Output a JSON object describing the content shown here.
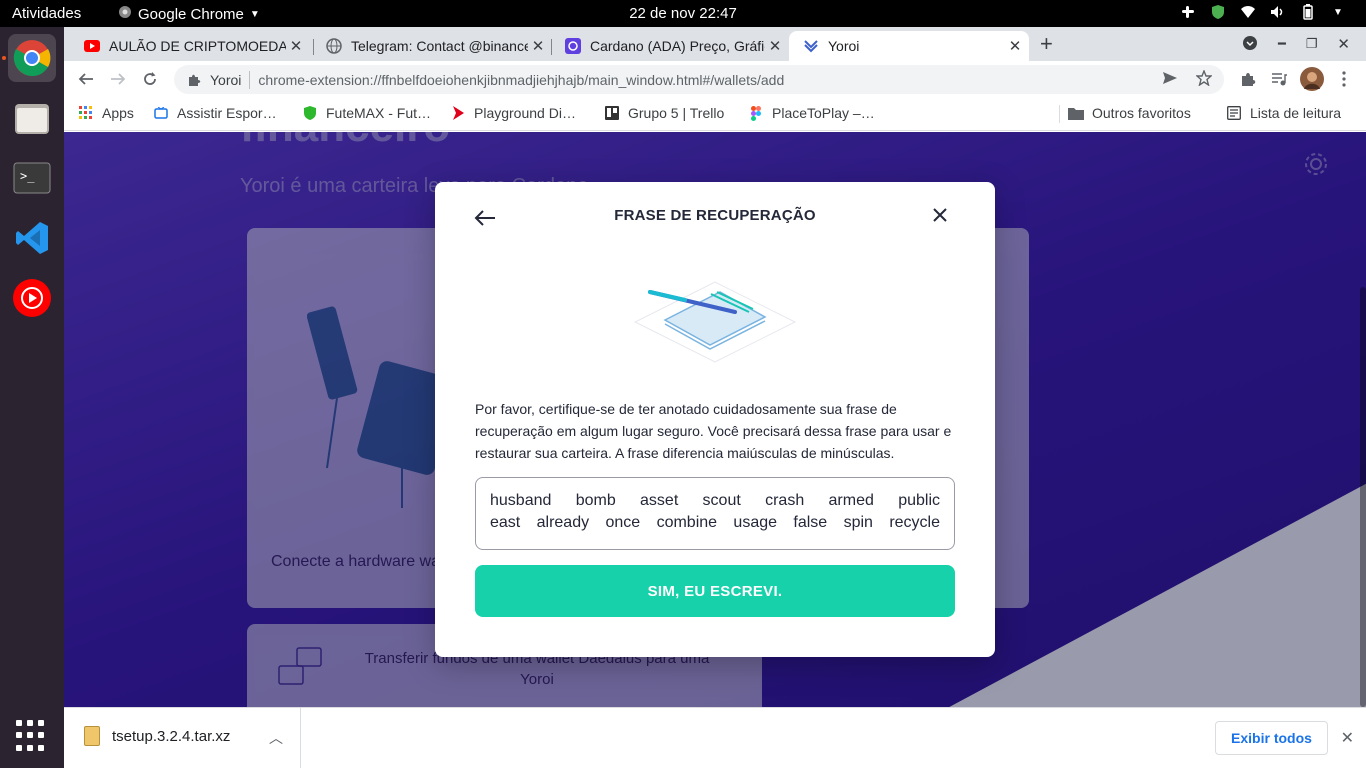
{
  "topbar": {
    "activities": "Atividades",
    "app_name": "Google Chrome",
    "clock": "22 de nov  22:47"
  },
  "dock": {
    "items": [
      "chrome-icon",
      "files-icon",
      "terminal-icon",
      "vscode-icon",
      "youtube-music-icon"
    ]
  },
  "tabs": [
    {
      "title": "AULÃO DE CRIPTOMOEDA",
      "icon": "youtube-icon"
    },
    {
      "title": "Telegram: Contact @binance",
      "icon": "globe-icon"
    },
    {
      "title": "Cardano (ADA) Preço, Gráfico",
      "icon": "coinmarketcap-icon"
    },
    {
      "title": "Yoroi",
      "icon": "yoroi-icon"
    }
  ],
  "omnibox": {
    "site": "Yoroi",
    "url": "chrome-extension://ffnbelfdoeiohenkjibnmadjiehjhajb/main_window.html#/wallets/add"
  },
  "bookmarks": [
    {
      "label": "Apps",
      "icon": "apps-grid-icon"
    },
    {
      "label": "Assistir Espor…",
      "icon": "tv-icon"
    },
    {
      "label": "FuteMAX - Fut…",
      "icon": "shield-icon"
    },
    {
      "label": "Playground Di…",
      "icon": "chevron-red-icon"
    },
    {
      "label": "Grupo 5 | Trello",
      "icon": "trello-icon"
    },
    {
      "label": "PlaceToPlay –…",
      "icon": "figma-icon"
    }
  ],
  "bookmarks_right": {
    "other": "Outros favoritos",
    "reading_list": "Lista de leitura"
  },
  "page": {
    "hero_title": "financeiro",
    "hero_subtitle": "Yoroi é uma carteira leve para Cardano",
    "hardware_label": "Conecte a hardware wallet",
    "transfer_label": "Transferir fundos de uma wallet Daedalus para uma Yoroi"
  },
  "dialog": {
    "title": "FRASE DE RECUPERAÇÃO",
    "message": "Por favor, certifique-se de ter anotado cuidadosamente sua frase de recuperação em algum lugar seguro.     Você precisará dessa frase para usar e restaurar sua carteira. A frase diferencia maiúsculas de minúsculas.",
    "phrase_line1": "husband bomb asset scout crash armed public",
    "phrase_line2": "east already once combine usage false spin recycle",
    "confirm_button": "SIM, EU ESCREVI."
  },
  "downloads": {
    "file": "tsetup.3.2.4.tar.xz",
    "show_all": "Exibir todos"
  },
  "colors": {
    "yoroi_purple": "#3f1fb6",
    "confirm_teal": "#17d1aa",
    "dock_bg": "#2b2330"
  }
}
